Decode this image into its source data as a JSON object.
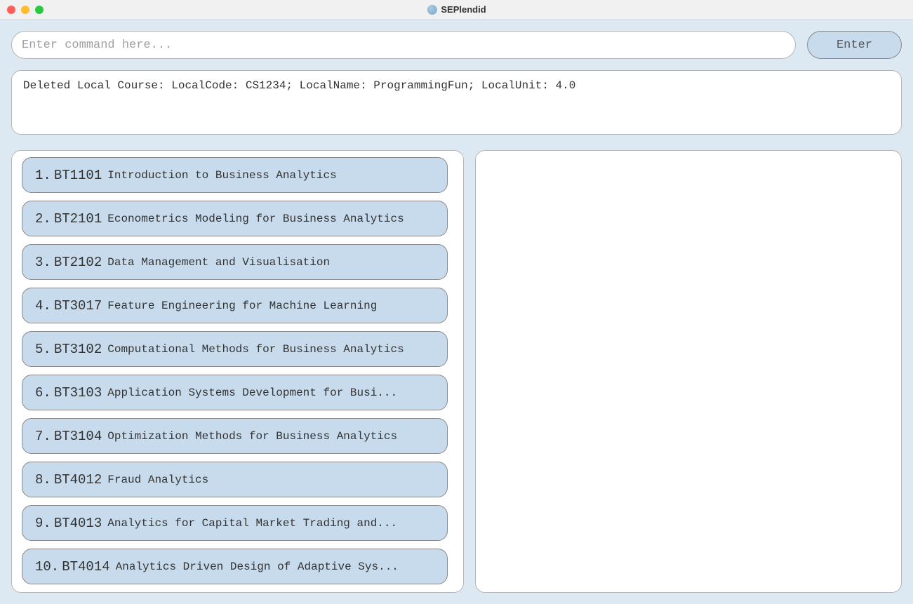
{
  "window": {
    "title": "SEPlendid"
  },
  "command": {
    "placeholder": "Enter command here...",
    "enter_label": "Enter"
  },
  "result": {
    "text": "Deleted Local Course: LocalCode: CS1234; LocalName: ProgrammingFun; LocalUnit: 4.0"
  },
  "courses": [
    {
      "index": "1.",
      "code": "BT1101",
      "name": "Introduction to Business Analytics"
    },
    {
      "index": "2.",
      "code": "BT2101",
      "name": "Econometrics Modeling for Business Analytics"
    },
    {
      "index": "3.",
      "code": "BT2102",
      "name": "Data Management and Visualisation"
    },
    {
      "index": "4.",
      "code": "BT3017",
      "name": "Feature Engineering for Machine Learning"
    },
    {
      "index": "5.",
      "code": "BT3102",
      "name": "Computational Methods for Business Analytics"
    },
    {
      "index": "6.",
      "code": "BT3103",
      "name": "Application Systems Development for Busi..."
    },
    {
      "index": "7.",
      "code": "BT3104",
      "name": "Optimization Methods for Business Analytics"
    },
    {
      "index": "8.",
      "code": "BT4012",
      "name": "Fraud Analytics"
    },
    {
      "index": "9.",
      "code": "BT4013",
      "name": "Analytics for Capital Market Trading and..."
    },
    {
      "index": "10.",
      "code": "BT4014",
      "name": "Analytics Driven Design of Adaptive Sys..."
    }
  ]
}
